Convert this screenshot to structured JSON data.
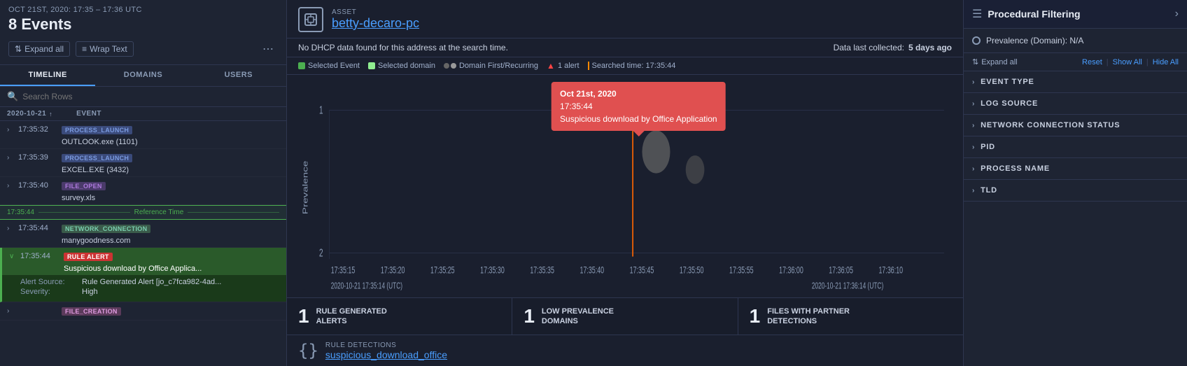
{
  "left": {
    "date_range": "OCT 21ST, 2020: 17:35 – 17:36 UTC",
    "event_count": "8 Events",
    "expand_all_label": "Expand all",
    "wrap_text_label": "Wrap Text",
    "tabs": [
      "TIMELINE",
      "DOMAINS",
      "USERS"
    ],
    "active_tab": "TIMELINE",
    "search_placeholder": "Search Rows",
    "col_date": "2020-10-21",
    "col_event": "EVENT",
    "events": [
      {
        "time": "17:35:32",
        "badge": "PROCESS_LAUNCH",
        "badge_type": "process",
        "name": "OUTLOOK.exe (1101)",
        "expanded": false,
        "selected": false
      },
      {
        "time": "17:35:39",
        "badge": "PROCESS_LAUNCH",
        "badge_type": "process",
        "name": "EXCEL.EXE (3432)",
        "expanded": false,
        "selected": false
      },
      {
        "time": "17:35:40",
        "badge": "FILE_OPEN",
        "badge_type": "file",
        "name": "survey.xls",
        "expanded": false,
        "selected": false
      },
      {
        "ref_time": "17:35:44",
        "is_ref": true,
        "ref_label": "Reference Time"
      },
      {
        "time": "17:35:44",
        "badge": "NETWORK_CONNECTION",
        "badge_type": "network",
        "name": "manygoodness.com",
        "expanded": false,
        "selected": false
      },
      {
        "time": "17:35:44",
        "badge": "RULE ALERT",
        "badge_type": "rule",
        "name": "Suspicious download by Office Applica...",
        "expanded": true,
        "selected": true,
        "details": [
          {
            "label": "Alert Source:",
            "value": "Rule Generated Alert [jo_c7fca982-4ad..."
          },
          {
            "label": "Severity:",
            "value": "High"
          }
        ]
      },
      {
        "time": "",
        "badge": "FILE_CREATION",
        "badge_type": "file_creation",
        "name": "",
        "expanded": false,
        "selected": false
      }
    ]
  },
  "middle": {
    "asset_label": "ASSET",
    "asset_name": "betty-decaro-pc",
    "dhcp_text": "No DHCP data found for this address at the search time.",
    "data_collected": "Data last collected:",
    "data_collected_value": "5 days ago",
    "legend": [
      {
        "label": "Selected Event",
        "color": "#4caf50",
        "shape": "square"
      },
      {
        "label": "Selected domain",
        "color": "#90ee90",
        "shape": "square"
      },
      {
        "label": "Domain First/Recurring",
        "color": "#888",
        "shape": "circle-pair"
      },
      {
        "label": "1 alert",
        "color": "#ff4444",
        "shape": "triangle"
      },
      {
        "label": "Searched time: 17:35:44",
        "color": "#ff6600",
        "shape": "line"
      }
    ],
    "chart": {
      "x_labels": [
        "17:35:15",
        "17:35:20",
        "17:35:25",
        "17:35:30",
        "17:35:35",
        "17:35:40",
        "17:35:45",
        "17:35:50",
        "17:35:55",
        "17:36:00",
        "17:36:05",
        "17:36:10"
      ],
      "x_sub_labels": [
        "2020-10-21 17:35:14 (UTC)",
        "2020-10-21 17:36:14 (UTC)"
      ],
      "y_label": "Prevalence",
      "y_values": [
        "1",
        "2"
      ],
      "alert_x": 0.635,
      "alert_y": 0.1,
      "domain1_x": 0.595,
      "domain1_y": 0.12,
      "domain2_x": 0.72,
      "domain2_y": 0.12
    },
    "tooltip": {
      "date": "Oct 21st, 2020",
      "time": "17:35:44",
      "text": "Suspicious download by Office Application"
    },
    "stats": [
      {
        "number": "1",
        "label": "RULE GENERATED\nALERTS"
      },
      {
        "number": "1",
        "label": "LOW PREVALENCE\nDOMAINS"
      },
      {
        "number": "1",
        "label": "FILES WITH PARTNER\nDETECTIONS"
      }
    ],
    "rule": {
      "label": "RULE DETECTIONS",
      "name": "suspicious_download_office"
    }
  },
  "right": {
    "title": "Procedural Filtering",
    "prevalence_label": "Prevalence (Domain): N/A",
    "expand_all_label": "Expand all",
    "reset_label": "Reset",
    "show_all_label": "Show All",
    "hide_all_label": "Hide All",
    "sections": [
      {
        "label": "EVENT TYPE"
      },
      {
        "label": "LOG SOURCE"
      },
      {
        "label": "NETWORK CONNECTION STATUS"
      },
      {
        "label": "PID"
      },
      {
        "label": "PROCESS NAME"
      },
      {
        "label": "TLD"
      }
    ]
  }
}
